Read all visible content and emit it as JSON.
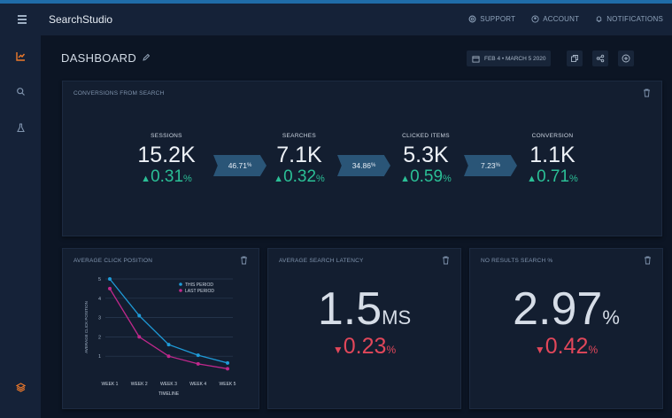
{
  "app": {
    "title": "SearchStudio"
  },
  "topnav": {
    "support": "SUPPORT",
    "account": "ACCOUNT",
    "notifications": "NOTIFICATIONS"
  },
  "page": {
    "title": "DASHBOARD",
    "date_range": "FEB 4 • MARCH 5 2020"
  },
  "funnel": {
    "title": "CONVERSIONS FROM SEARCH",
    "stages": [
      {
        "label": "SESSIONS",
        "value": "15.2K",
        "change": "0.31",
        "unit": "%"
      },
      {
        "label": "SEARCHES",
        "value": "7.1K",
        "change": "0.32",
        "unit": "%"
      },
      {
        "label": "CLICKED ITEMS",
        "value": "5.3K",
        "change": "0.59",
        "unit": "%"
      },
      {
        "label": "CONVERSION",
        "value": "1.1K",
        "change": "0.71",
        "unit": "%"
      }
    ],
    "rates": [
      {
        "value": "46.71",
        "unit": "%"
      },
      {
        "value": "34.86",
        "unit": "%"
      },
      {
        "value": "7.23",
        "unit": "%"
      }
    ]
  },
  "latency": {
    "title": "AVERAGE SEARCH LATENCY",
    "value": "1.5",
    "unit": "MS",
    "change": "0.23",
    "change_unit": "%"
  },
  "no_results": {
    "title": "NO RESULTS SEARCH %",
    "value": "2.97",
    "unit": "%",
    "change": "0.42",
    "change_unit": "%"
  },
  "colors": {
    "accent": "#f07a2a",
    "positive": "#2bbf96",
    "negative": "#e2475a",
    "this_period": "#1f9bd8",
    "last_period": "#c0288c"
  },
  "chart_data": {
    "type": "line",
    "title": "AVERAGE CLICK POSITION",
    "xlabel": "TIMELINE",
    "ylabel": "AVERAGE CLICK POSITION",
    "categories": [
      "WEEK 1",
      "WEEK 2",
      "WEEK 3",
      "WEEK 4",
      "WEEK 5"
    ],
    "y_ticks": [
      "1",
      "2",
      "3",
      "4",
      "5"
    ],
    "ylim": [
      0,
      5
    ],
    "grid": true,
    "legend": "top-right",
    "series": [
      {
        "name": "THIS PERIOD",
        "color": "#1f9bd8",
        "values": [
          5,
          3.1,
          1.6,
          1.05,
          0.65
        ]
      },
      {
        "name": "LAST PERIOD",
        "color": "#c0288c",
        "values": [
          4.5,
          2,
          1,
          0.6,
          0.35
        ]
      }
    ]
  }
}
